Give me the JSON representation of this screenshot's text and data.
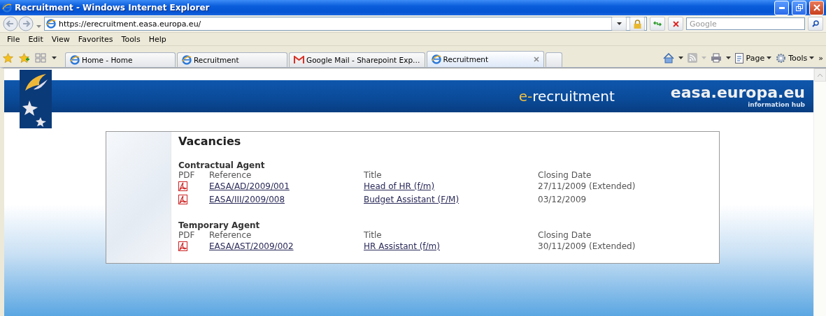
{
  "window": {
    "title": "Recruitment - Windows Internet Explorer"
  },
  "address_bar": {
    "url": "https://erecruitment.easa.europa.eu/"
  },
  "search": {
    "placeholder": "Google"
  },
  "menu": [
    "File",
    "Edit",
    "View",
    "Favorites",
    "Tools",
    "Help"
  ],
  "tabs": [
    {
      "label": "Home - Home",
      "kind": "browser",
      "selected": false
    },
    {
      "label": "Recruitment",
      "kind": "browser",
      "selected": false
    },
    {
      "label": "Google Mail - Sharepoint Exp…",
      "kind": "mail",
      "selected": false
    },
    {
      "label": "Recruitment",
      "kind": "browser",
      "selected": true
    }
  ],
  "command_bar": {
    "items": [
      "Page",
      "Tools"
    ],
    "overflow": "»"
  },
  "banner": {
    "app_prefix": "e-",
    "app_name": "recruitment",
    "site": "easa.europa.eu",
    "tagline": "information hub"
  },
  "page": {
    "heading": "Vacancies",
    "sections": [
      {
        "title": "Contractual Agent",
        "columns": [
          "PDF",
          "Reference",
          "Title",
          "Closing Date"
        ],
        "rows": [
          {
            "reference": "EASA/AD/2009/001",
            "title": "Head of HR (f/m)",
            "closing_date": "27/11/2009 (Extended)"
          },
          {
            "reference": "EASA/III/2009/008",
            "title": "Budget Assistant (F/M)",
            "closing_date": "03/12/2009"
          }
        ]
      },
      {
        "title": "Temporary Agent",
        "columns": [
          "PDF",
          "Reference",
          "Title",
          "Closing Date"
        ],
        "rows": [
          {
            "reference": "EASA/AST/2009/002",
            "title": "HR Assistant (f/m)",
            "closing_date": "30/11/2009 (Extended)"
          }
        ]
      }
    ]
  }
}
